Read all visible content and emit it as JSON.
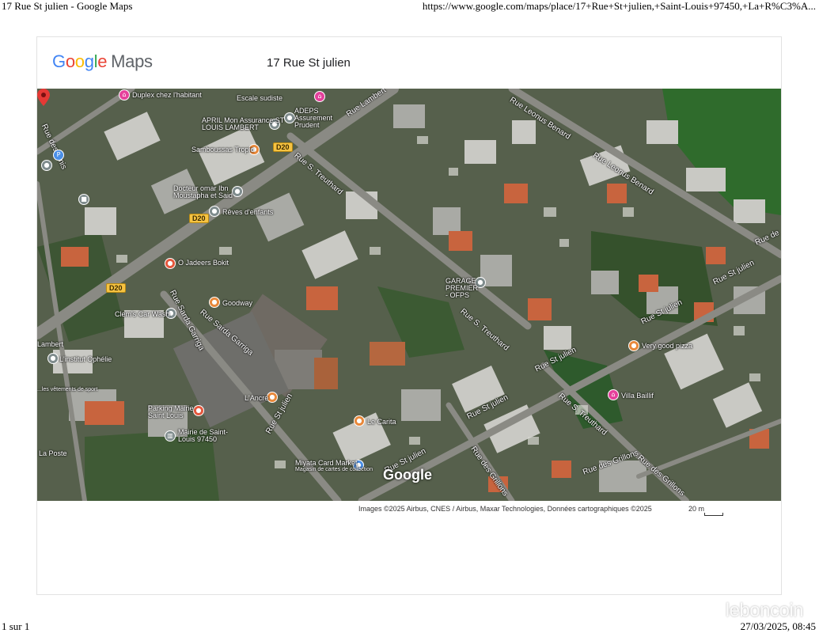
{
  "browser": {
    "title": "17 Rue St julien - Google Maps",
    "url": "https://www.google.com/maps/place/17+Rue+St+julien,+Saint-Louis+97450,+La+R%C3%A...",
    "page_count": "1 sur 1",
    "datetime": "27/03/2025, 08:45"
  },
  "header": {
    "logo_letters": [
      "G",
      "o",
      "o",
      "g",
      "l",
      "e"
    ],
    "logo_suffix": "Maps",
    "address": "17 Rue St julien"
  },
  "map": {
    "view": "satellite",
    "watermark": "Google",
    "attribution": "Images ©2025 Airbus, CNES / Airbus, Maxar Technologies, Données cartographiques ©2025",
    "scale_label": "20 m",
    "selected_marker_color": "#e53935",
    "street_labels": [
      "Rue des Amis",
      "Rue Lambert",
      "Rue Leonus Benard",
      "Rue Leonus Benard",
      "Rue S. Treuthard",
      "Rue Sarda Garriga",
      "Rue Sarda Garriga",
      "Rue St julien",
      "Rue St julien",
      "Rue St julien",
      "Rue St julien",
      "Rue St julien",
      "Rue S. Treuthard",
      "Rue S. Treuthard",
      "Rue des Grillons",
      "Rue des Grillons",
      "Rue des Grillons",
      "Rue St julien",
      "Rue de"
    ],
    "route_shields": [
      "D20",
      "D20",
      "D20"
    ],
    "poi_labels": [
      "Duplex chez l'habitant",
      "Escale sudiste",
      "APRIL Mon Assurance ST LOUIS LAMBERT",
      "ADEPS Assurement Prudent",
      "Samboussas Tropic",
      "Docteur omar Ibn Moustapha et Said",
      "Rêves d'enfants",
      "O Jadeers Bokit",
      "Goodway",
      "Clem's Car Wash",
      "L'institut Ophélie",
      "Parking Mairie Saint Louis",
      "Mairie de Saint-Louis 97450",
      "La Poste",
      "L'Ancre",
      "Le Carita",
      "Miyata Card Market",
      "Magasin de cartes de collection",
      "GARAGE PREMIER - OFPS",
      "Very good pizza",
      "Villa Baillif",
      "Rue Sarda Garriga",
      "Lambert",
      "...les vêtements de sport"
    ]
  },
  "watermark": "leboncoin"
}
